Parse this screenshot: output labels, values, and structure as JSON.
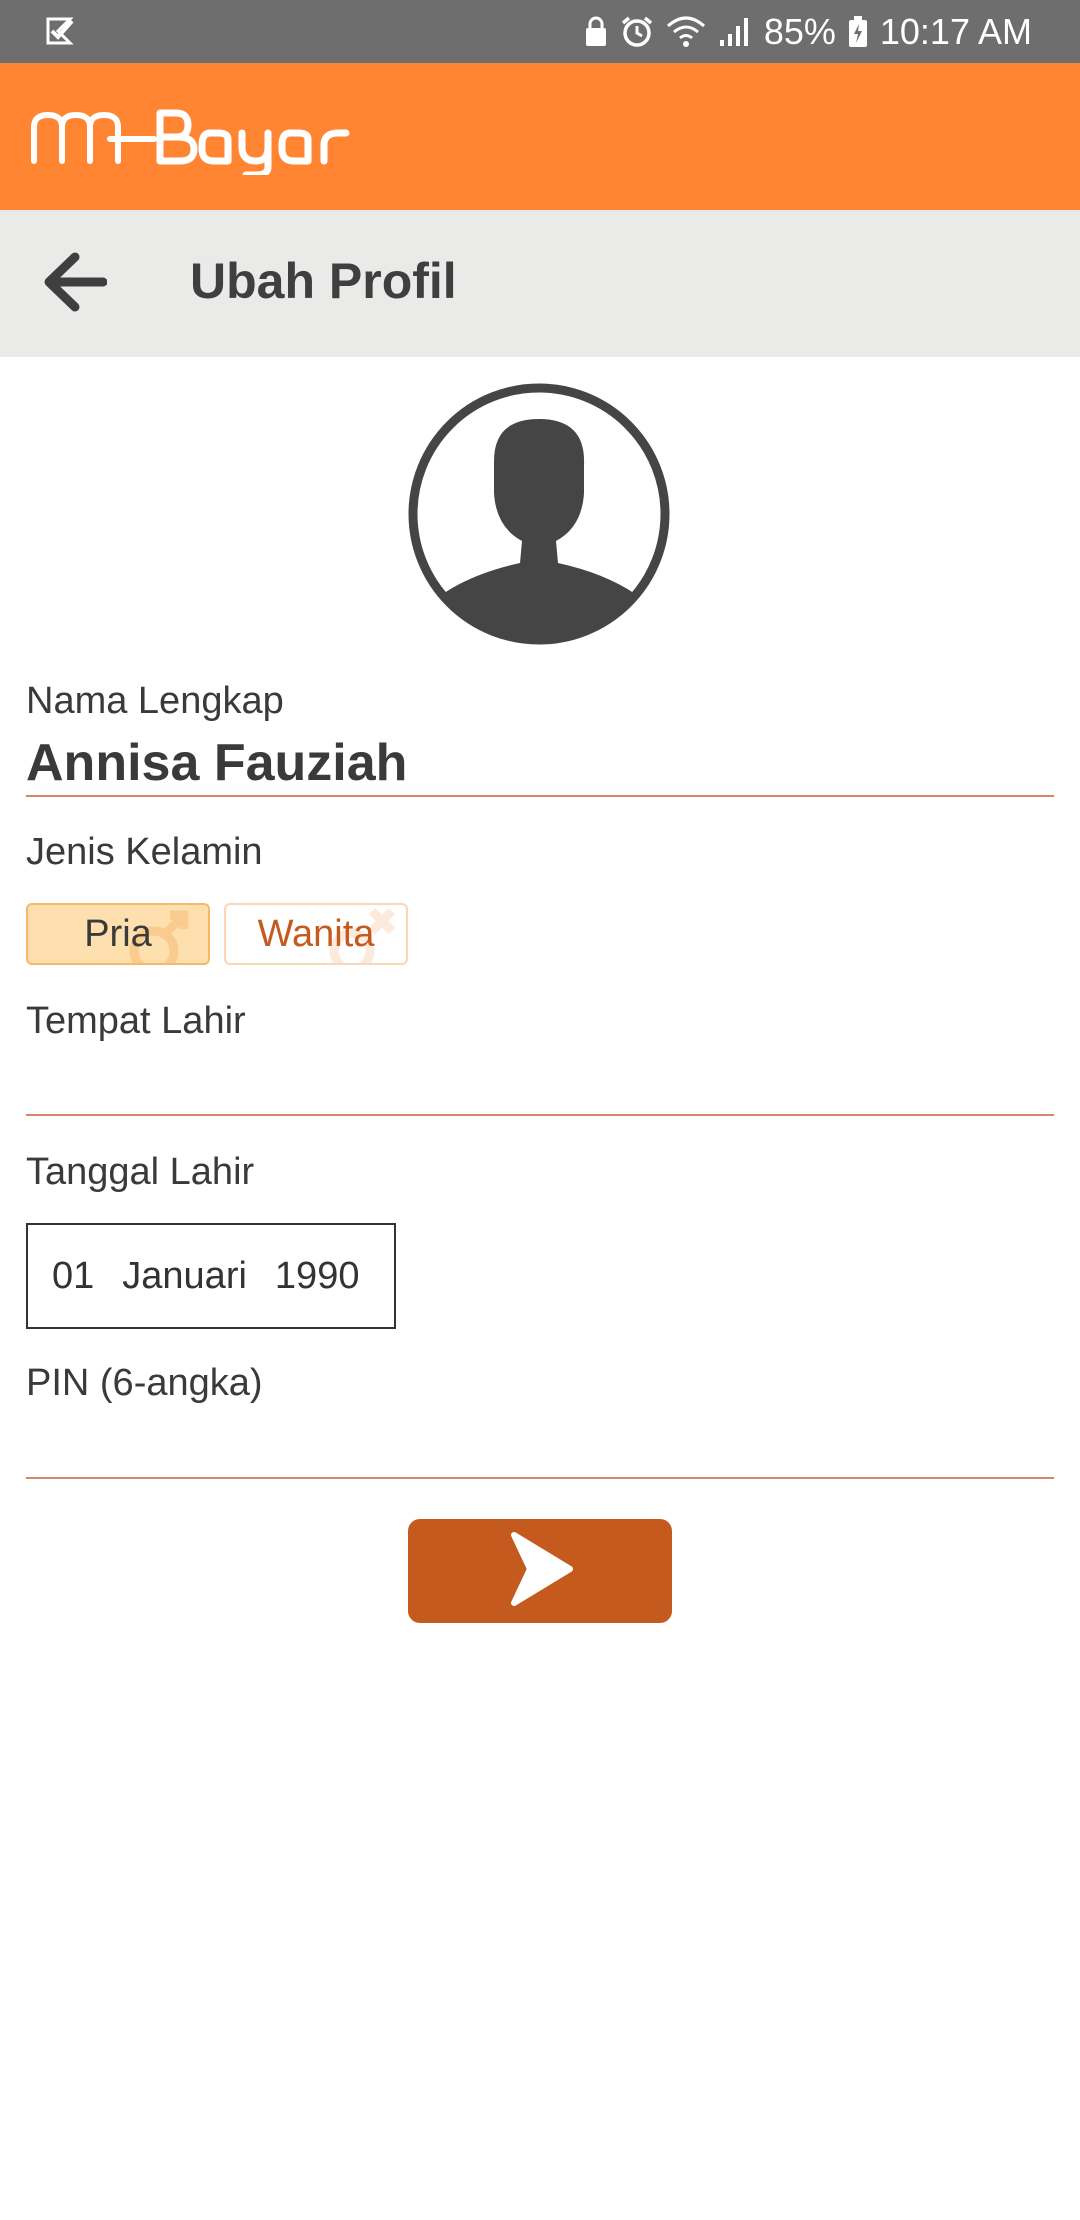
{
  "status_bar": {
    "battery": "85%",
    "time": "10:17 AM",
    "icons": [
      "notification-icon",
      "lock-icon",
      "alarm-icon",
      "wifi-icon",
      "signal-icon",
      "battery-icon"
    ]
  },
  "header": {
    "logo_text": "mBayar",
    "brand_color": "#ff8533"
  },
  "title_bar": {
    "back_icon": "arrow-left-icon",
    "title": "Ubah Profil"
  },
  "profile": {
    "avatar_icon": "user-avatar-icon",
    "name_label": "Nama Lengkap",
    "name_value": "Annisa Fauziah",
    "gender_label": "Jenis Kelamin",
    "gender_options": [
      "Pria",
      "Wanita"
    ],
    "gender_selected": "Pria",
    "birthplace_label": "Tempat Lahir",
    "birthplace_value": "",
    "birthdate_label": "Tanggal Lahir",
    "birthdate": {
      "day": "01",
      "month": "Januari",
      "year": "1990"
    },
    "pin_label": "PIN (6-angka)",
    "pin_value": ""
  },
  "actions": {
    "next_icon": "chevron-right-icon",
    "accent_color": "#c55a1f"
  }
}
